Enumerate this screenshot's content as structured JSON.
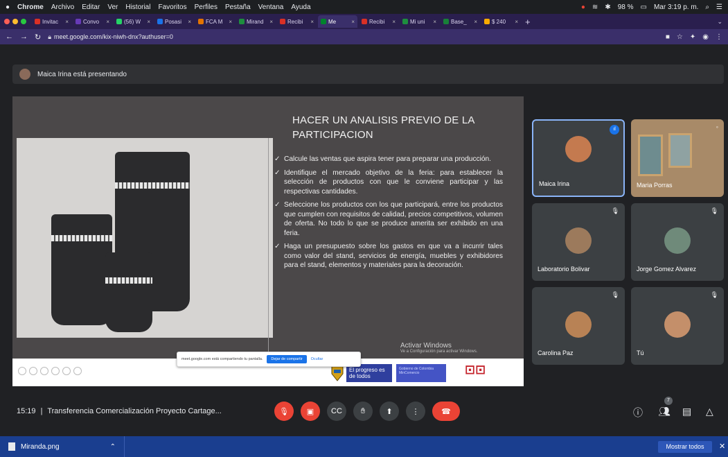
{
  "macbar": {
    "app": "Chrome",
    "menu": [
      "Archivo",
      "Editar",
      "Ver",
      "Historial",
      "Favoritos",
      "Perfiles",
      "Pestaña",
      "Ventana",
      "Ayuda"
    ],
    "battery": "98 %",
    "datetime": "Mar 3:19 p. m."
  },
  "tabs": [
    {
      "label": "Invitac",
      "fav": "#d93025"
    },
    {
      "label": "Convo",
      "fav": "#673ab7"
    },
    {
      "label": "(56) W",
      "fav": "#25d366"
    },
    {
      "label": "Posasi",
      "fav": "#1a73e8"
    },
    {
      "label": "FCA M",
      "fav": "#e37400"
    },
    {
      "label": "Mirand",
      "fav": "#1e8e3e"
    },
    {
      "label": "Recibi",
      "fav": "#d93025"
    },
    {
      "label": "Me",
      "fav": "#00832d",
      "active": true
    },
    {
      "label": "Recibi",
      "fav": "#d93025"
    },
    {
      "label": "Mi uni",
      "fav": "#1e8e3e"
    },
    {
      "label": "Base_",
      "fav": "#188038"
    },
    {
      "label": "$ 240",
      "fav": "#f9ab00"
    }
  ],
  "address": {
    "url": "meet.google.com/kix-niwh-dnx?authuser=0"
  },
  "presenting": {
    "text": "Maica Irina está presentando"
  },
  "slide": {
    "title": "HACER UN ANALISIS PREVIO DE LA PARTICIPACION",
    "bullets": [
      "Calcule las ventas que aspira tener para preparar una producción.",
      "Identifique el mercado objetivo de la feria: para establecer la selección de productos con que le conviene participar y las respectivas cantidades.",
      "Seleccione los productos con los que participará, entre los productos que cumplen con requisitos de calidad, precios competitivos, volumen de oferta. No todo lo que se produce amerita ser exhibido en una feria.",
      "Haga un presupuesto sobre los gastos en que va a incurrir tales como valor del stand, servicios de energía, muebles y exhibidores para el stand, elementos y materiales para la decoración."
    ],
    "footer_logo2": "El progreso es de todos",
    "footer_logo3": "Gobierno de Colombia MinComercio",
    "activate_title": "Activar Windows",
    "activate_sub": "Ve a Configuración para activar Windows."
  },
  "sharebar": {
    "text": "meet.google.com está compartiendo tu pantalla.",
    "stop": "Dejar de compartir",
    "hide": "Ocultar"
  },
  "participants": [
    {
      "name": "Maica Irina",
      "speaking": true
    },
    {
      "name": "Maria Porras"
    },
    {
      "name": "Laboratorio Bolivar"
    },
    {
      "name": "Jorge Gomez Alvarez"
    },
    {
      "name": "Carolina Paz"
    },
    {
      "name": "Tú"
    }
  ],
  "controls": {
    "time": "15:19",
    "separator": "|",
    "meeting_title": "Transferencia Comercialización Proyecto Cartage...",
    "people_count": "7"
  },
  "downloads": {
    "file": "Miranda.png",
    "show_all": "Mostrar todos"
  }
}
